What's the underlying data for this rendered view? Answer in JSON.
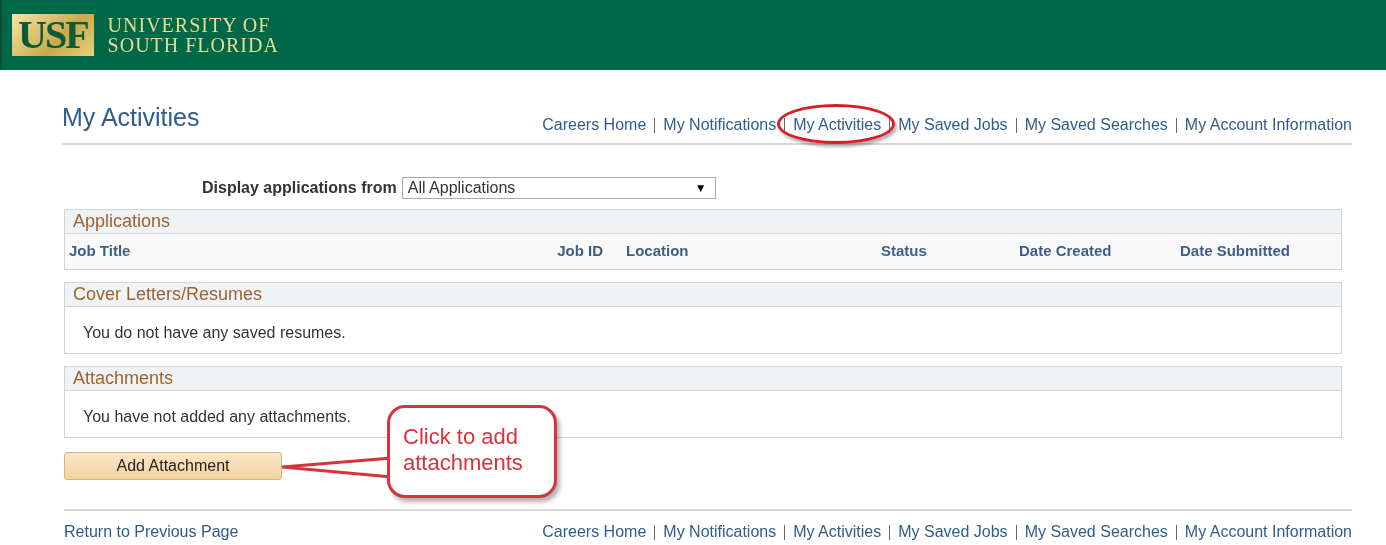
{
  "header": {
    "logo": "USF",
    "university_name": [
      "UNIVERSITY OF",
      "SOUTH FLORIDA"
    ]
  },
  "page_title": "My Activities",
  "top_nav": [
    {
      "label": "Careers Home",
      "circled": false
    },
    {
      "label": "My Notifications",
      "circled": false
    },
    {
      "label": "My Activities",
      "circled": true
    },
    {
      "label": "My Saved Jobs",
      "circled": false
    },
    {
      "label": "My Saved Searches",
      "circled": false
    },
    {
      "label": "My Account Information",
      "circled": false
    }
  ],
  "filter": {
    "label": "Display applications from",
    "value": "All Applications",
    "caret": "▼"
  },
  "applications": {
    "title": "Applications",
    "columns": [
      "Job Title",
      "Job ID",
      "Location",
      "Status",
      "Date Created",
      "Date Submitted"
    ]
  },
  "cover_letters": {
    "title": "Cover Letters/Resumes",
    "message": "You do not have any saved resumes."
  },
  "attachments": {
    "title": "Attachments",
    "message": "You have not added any attachments."
  },
  "add_button": "Add Attachment",
  "callout": {
    "text": "Click to add attachments"
  },
  "footer": {
    "return_link": "Return to Previous Page",
    "nav": [
      "Careers Home",
      "My Notifications",
      "My Activities",
      "My Saved Jobs",
      "My Saved Searches",
      "My Account Information"
    ]
  }
}
